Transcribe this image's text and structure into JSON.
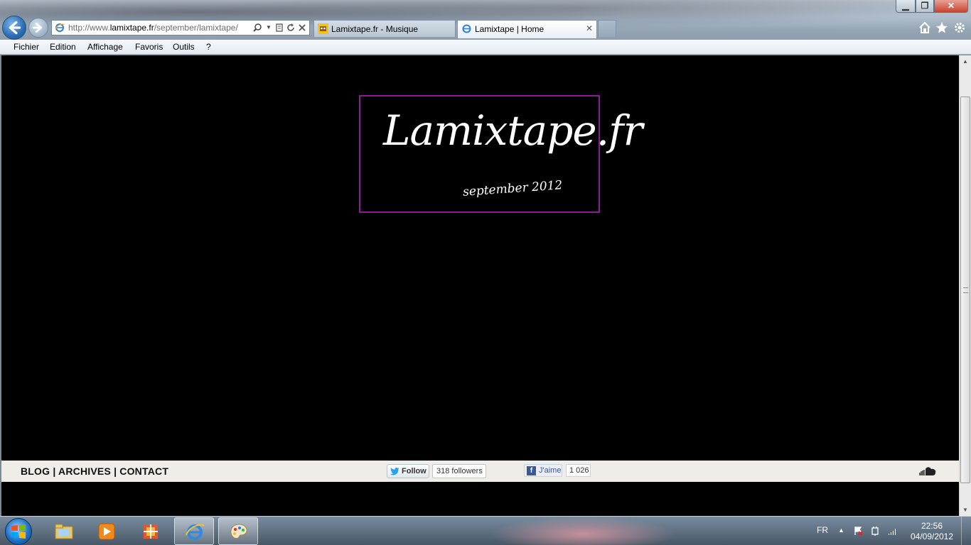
{
  "browser": {
    "address_prefix": "http://www.",
    "address_domain": "lamixtape.fr",
    "address_path": "/september/lamixtape/",
    "tabs": [
      {
        "label": "Lamixtape.fr - Musique"
      },
      {
        "label": "Lamixtape | Home"
      }
    ],
    "tab_close_glyph": "✕",
    "window_controls": {
      "minimize": "▁",
      "maximize": "❐",
      "close": "✕"
    }
  },
  "menu": [
    "Fichier",
    "Edition",
    "Affichage",
    "Favoris",
    "Outils",
    "?"
  ],
  "page": {
    "logo_text": "Lamixtape.fr",
    "logo_subtitle": "september 2012",
    "footer_nav": {
      "blog": "BLOG",
      "archives": "ARCHIVES",
      "contact": "CONTACT",
      "separator": " | "
    },
    "twitter": {
      "follow_label": "Follow",
      "followers": "318 followers"
    },
    "facebook": {
      "like_label": "J'aime",
      "count": "1 026"
    }
  },
  "taskbar": {
    "lang": "FR",
    "time": "22:56",
    "date": "04/09/2012"
  },
  "colors": {
    "page_bg": "#000000",
    "logo_border": "#8b1a98",
    "footer_bg": "#eeede8"
  }
}
